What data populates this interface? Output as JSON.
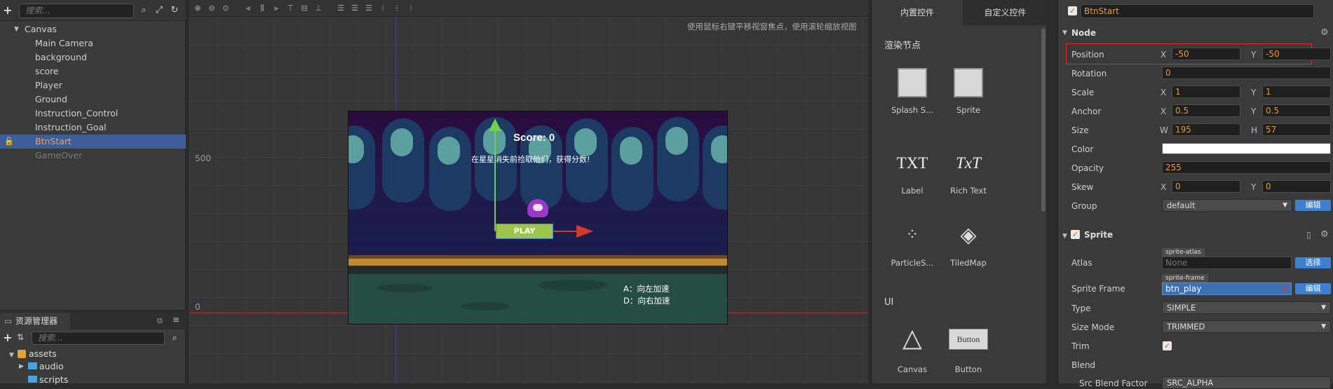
{
  "hierarchy": {
    "search_placeholder": "搜索...",
    "nodes": [
      {
        "label": "Canvas"
      },
      {
        "label": "Main Camera"
      },
      {
        "label": "background"
      },
      {
        "label": "score"
      },
      {
        "label": "Player"
      },
      {
        "label": "Ground"
      },
      {
        "label": "Instruction_Control"
      },
      {
        "label": "Instruction_Goal"
      },
      {
        "label": "BtnStart"
      },
      {
        "label": "GameOver"
      }
    ]
  },
  "assets": {
    "tab_label": "资源管理器",
    "search_placeholder": "搜索...",
    "items": [
      {
        "label": "assets"
      },
      {
        "label": "audio"
      },
      {
        "label": "scripts"
      }
    ]
  },
  "scene": {
    "hint": "使用鼠标右键平移视窗焦点，使用滚轮缩放视图",
    "axis_500": "500",
    "axis_0": "0",
    "game": {
      "score_text": "Score: 0",
      "goal_text": "在星星消失前捡取他们，获得分数!",
      "play_label": "PLAY",
      "control_line1": "A：向左加速",
      "control_line2": "D：向右加速"
    }
  },
  "library": {
    "tabs": [
      "内置控件",
      "自定义控件"
    ],
    "section_render": "渲染节点",
    "section_ui": "UI",
    "render_items": [
      "Splash S...",
      "Sprite",
      "Label",
      "Rich Text",
      "ParticleS...",
      "TiledMap"
    ],
    "label_icon_txt": "TXT",
    "rich_icon_txt": "TxT",
    "ui_items": [
      "Canvas",
      "Button"
    ],
    "button_icon_text": "Button"
  },
  "inspector": {
    "node_name": "BtnStart",
    "section_node": "Node",
    "position_label": "Position",
    "position_x": "-50",
    "position_y": "-50",
    "rotation_label": "Rotation",
    "rotation": "0",
    "scale_label": "Scale",
    "scale_x": "1",
    "scale_y": "1",
    "anchor_label": "Anchor",
    "anchor_x": "0.5",
    "anchor_y": "0.5",
    "size_label": "Size",
    "size_w": "195",
    "size_h": "57",
    "color_label": "Color",
    "opacity_label": "Opacity",
    "opacity": "255",
    "skew_label": "Skew",
    "skew_x": "0",
    "skew_y": "0",
    "group_label": "Group",
    "group_value": "default",
    "edit_label": "编辑",
    "section_sprite": "Sprite",
    "atlas_label": "Atlas",
    "atlas_tag": "sprite-atlas",
    "atlas_value": "None",
    "select_label": "选择",
    "sprite_frame_label": "Sprite Frame",
    "sprite_frame_tag": "sprite-frame",
    "sprite_frame_value": "btn_play",
    "type_label": "Type",
    "type_value": "SIMPLE",
    "size_mode_label": "Size Mode",
    "size_mode_value": "TRIMMED",
    "trim_label": "Trim",
    "blend_label": "Blend",
    "src_blend_label": "Src Blend Factor",
    "src_blend_value": "SRC_ALPHA",
    "x": "X",
    "y": "Y",
    "w": "W",
    "h": "H"
  },
  "colors": {
    "accent": "#e99a35",
    "selection": "#3e5d98",
    "highlight_box": "#d9342b"
  }
}
